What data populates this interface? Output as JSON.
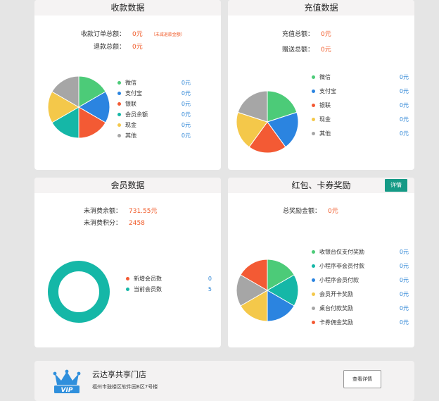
{
  "colors": {
    "green": "#4ccb78",
    "blue": "#2b84e0",
    "red": "#f35a34",
    "teal": "#15b7a7",
    "yellow": "#f4c84a",
    "gray": "#a6a6a6",
    "accent_value": "#f05a28",
    "amount_blue": "#2f86d6"
  },
  "collection": {
    "title": "收款数据",
    "summary": [
      {
        "label": "收款订单总额：",
        "value": "0元",
        "note": "（未减退款金额）"
      },
      {
        "label": "退款总额：",
        "value": "0元"
      }
    ],
    "chart_data": {
      "type": "pie",
      "categories": [
        "微信",
        "支付宝",
        "银联",
        "会员余额",
        "现金",
        "其他"
      ],
      "values": [
        0,
        0,
        0,
        0,
        0,
        0
      ],
      "slice_colors": [
        "#4ccb78",
        "#2b84e0",
        "#f35a34",
        "#15b7a7",
        "#f4c84a",
        "#a6a6a6"
      ]
    },
    "legend": [
      {
        "name": "微信",
        "amount": "0元",
        "color": "#4ccb78"
      },
      {
        "name": "支付宝",
        "amount": "0元",
        "color": "#2b84e0"
      },
      {
        "name": "银联",
        "amount": "0元",
        "color": "#f35a34"
      },
      {
        "name": "会员余额",
        "amount": "0元",
        "color": "#15b7a7"
      },
      {
        "name": "现金",
        "amount": "0元",
        "color": "#f4c84a"
      },
      {
        "name": "其他",
        "amount": "0元",
        "color": "#a6a6a6"
      }
    ]
  },
  "recharge": {
    "title": "充值数据",
    "summary": [
      {
        "label": "充值总额：",
        "value": "0元"
      },
      {
        "label": "赠送总额：",
        "value": "0元"
      }
    ],
    "chart_data": {
      "type": "pie",
      "categories": [
        "微信",
        "支付宝",
        "银联",
        "现金",
        "其他"
      ],
      "values": [
        0,
        0,
        0,
        0,
        0
      ],
      "slice_colors": [
        "#4ccb78",
        "#2b84e0",
        "#f35a34",
        "#f4c84a",
        "#a6a6a6"
      ]
    },
    "legend": [
      {
        "name": "微信",
        "amount": "0元",
        "color": "#4ccb78"
      },
      {
        "name": "支付宝",
        "amount": "0元",
        "color": "#2b84e0"
      },
      {
        "name": "银联",
        "amount": "0元",
        "color": "#f35a34"
      },
      {
        "name": "现金",
        "amount": "0元",
        "color": "#f4c84a"
      },
      {
        "name": "其他",
        "amount": "0元",
        "color": "#a6a6a6"
      }
    ]
  },
  "members": {
    "title": "会员数据",
    "summary": [
      {
        "label": "未消费余额：",
        "value": "731.55元"
      },
      {
        "label": "未消费积分：",
        "value": "2458"
      }
    ],
    "chart_data": {
      "type": "pie",
      "categories": [
        "新增会员数",
        "当前会员数"
      ],
      "values": [
        0,
        5
      ],
      "slice_colors": [
        "#f35a34",
        "#15b7a7"
      ]
    },
    "legend": [
      {
        "name": "新增会员数",
        "amount": "0",
        "color": "#f35a34"
      },
      {
        "name": "当前会员数",
        "amount": "5",
        "color": "#15b7a7"
      }
    ]
  },
  "rewards": {
    "title": "红包、卡券奖励",
    "detail_button": "详情",
    "summary": [
      {
        "label": "总奖励金额：",
        "value": "0元"
      }
    ],
    "chart_data": {
      "type": "pie",
      "categories": [
        "收银台仅支付奖励",
        "小程序非会员付款",
        "小程序会员付款",
        "会员开卡奖励",
        "桌台付款奖励",
        "卡券佣金奖励"
      ],
      "values": [
        0,
        0,
        0,
        0,
        0,
        0
      ],
      "slice_colors": [
        "#4ccb78",
        "#15b7a7",
        "#2b84e0",
        "#f4c84a",
        "#a6a6a6",
        "#f35a34"
      ]
    },
    "legend": [
      {
        "name": "收银台仅支付奖励",
        "amount": "0元",
        "color": "#4ccb78"
      },
      {
        "name": "小程序非会员付款",
        "amount": "0元",
        "color": "#15b7a7"
      },
      {
        "name": "小程序会员付款",
        "amount": "0元",
        "color": "#2b84e0"
      },
      {
        "name": "会员开卡奖励",
        "amount": "0元",
        "color": "#f4c84a"
      },
      {
        "name": "桌台付款奖励",
        "amount": "0元",
        "color": "#a6a6a6"
      },
      {
        "name": "卡券佣金奖励",
        "amount": "0元",
        "color": "#f35a34"
      }
    ]
  },
  "store": {
    "logo_text": "VIP",
    "name": "云达享共享门店",
    "address": "福州市鼓楼区软件园B区7号楼",
    "view_button": "查看详情"
  }
}
